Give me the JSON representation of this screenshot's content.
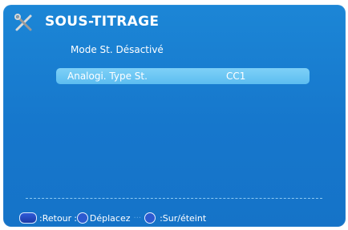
{
  "header": {
    "title": "SOUS-TITRAGE",
    "icon": "tools-icon"
  },
  "menu": {
    "items": [
      {
        "label": "Mode St. Désactivé",
        "value": ""
      },
      {
        "label": "Analogi. Type St.",
        "value": "CC1",
        "selected": true
      }
    ]
  },
  "footer": {
    "back_label": "Retour",
    "move_label": "Déplacez",
    "onoff_label": "Sur/éteint",
    "separator": ":"
  },
  "colors": {
    "background": "#1677cc",
    "highlight": "#6cc6f4",
    "text": "#ffffff"
  }
}
